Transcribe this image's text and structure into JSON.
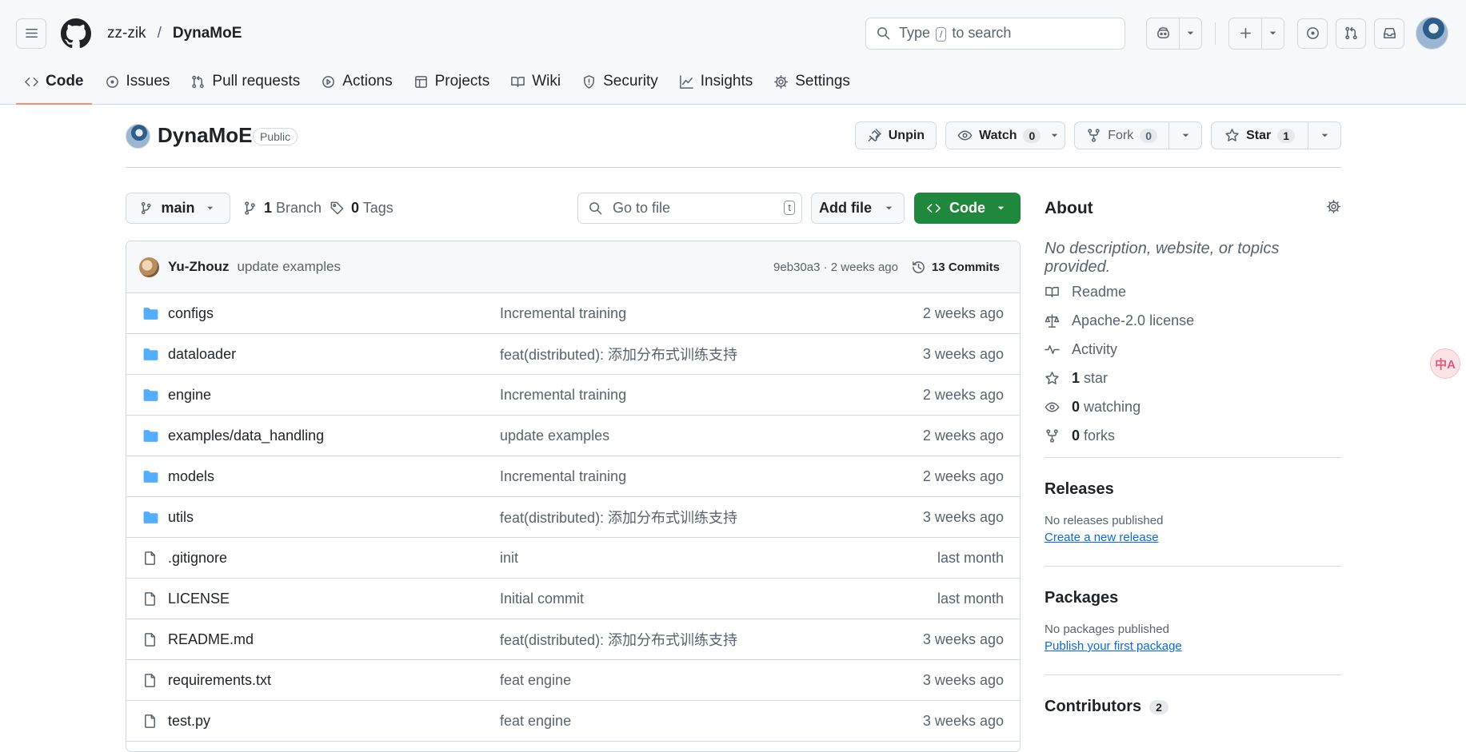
{
  "header": {
    "owner": "zz-zik",
    "separator": "/",
    "repo": "DynaMoE",
    "search_prefix": "Type",
    "search_key": "/",
    "search_suffix": "to search"
  },
  "tabs": [
    {
      "label": "Code",
      "icon": "code-icon"
    },
    {
      "label": "Issues",
      "icon": "issue-icon"
    },
    {
      "label": "Pull requests",
      "icon": "pull-request-icon"
    },
    {
      "label": "Actions",
      "icon": "play-icon"
    },
    {
      "label": "Projects",
      "icon": "table-icon"
    },
    {
      "label": "Wiki",
      "icon": "book-icon"
    },
    {
      "label": "Security",
      "icon": "shield-icon"
    },
    {
      "label": "Insights",
      "icon": "graph-icon"
    },
    {
      "label": "Settings",
      "icon": "gear-icon"
    }
  ],
  "repo": {
    "name": "DynaMoE",
    "visibility": "Public",
    "unpin": "Unpin",
    "watch": "Watch",
    "watch_count": "0",
    "fork": "Fork",
    "fork_count": "0",
    "star": "Star",
    "star_count": "1"
  },
  "toolbar": {
    "branch": "main",
    "branch_count": "1",
    "branch_label": "Branch",
    "tag_count": "0",
    "tag_label": "Tags",
    "goto_placeholder": "Go to file",
    "goto_key": "t",
    "add_file": "Add file",
    "code": "Code"
  },
  "commit": {
    "author": "Yu-Zhouz",
    "message": "update examples",
    "meta": "9eb30a3 · 2 weeks ago",
    "commits": "13 Commits"
  },
  "files": [
    {
      "type": "dir",
      "name": "configs",
      "message": "Incremental training",
      "date": "2 weeks ago"
    },
    {
      "type": "dir",
      "name": "dataloader",
      "message": "feat(distributed): 添加分布式训练支持",
      "date": "3 weeks ago"
    },
    {
      "type": "dir",
      "name": "engine",
      "message": "Incremental training",
      "date": "2 weeks ago"
    },
    {
      "type": "dir",
      "name": "examples/data_handling",
      "message": "update examples",
      "date": "2 weeks ago"
    },
    {
      "type": "dir",
      "name": "models",
      "message": "Incremental training",
      "date": "2 weeks ago"
    },
    {
      "type": "dir",
      "name": "utils",
      "message": "feat(distributed): 添加分布式训练支持",
      "date": "3 weeks ago"
    },
    {
      "type": "file",
      "name": ".gitignore",
      "message": "init",
      "date": "last month"
    },
    {
      "type": "file",
      "name": "LICENSE",
      "message": "Initial commit",
      "date": "last month"
    },
    {
      "type": "file",
      "name": "README.md",
      "message": "feat(distributed): 添加分布式训练支持",
      "date": "3 weeks ago"
    },
    {
      "type": "file",
      "name": "requirements.txt",
      "message": "feat engine",
      "date": "3 weeks ago"
    },
    {
      "type": "file",
      "name": "test.py",
      "message": "feat engine",
      "date": "3 weeks ago"
    }
  ],
  "about": {
    "title": "About",
    "description": "No description, website, or topics provided.",
    "readme": "Readme",
    "license": "Apache-2.0 license",
    "activity": "Activity",
    "stars_count": "1",
    "stars_label": "star",
    "watching_count": "0",
    "watching_label": "watching",
    "forks_count": "0",
    "forks_label": "forks"
  },
  "releases": {
    "title": "Releases",
    "text": "No releases published",
    "link": "Create a new release"
  },
  "packages": {
    "title": "Packages",
    "text": "No packages published",
    "link": "Publish your first package"
  },
  "contributors": {
    "title": "Contributors",
    "count": "2"
  },
  "translate_fab": "中A"
}
